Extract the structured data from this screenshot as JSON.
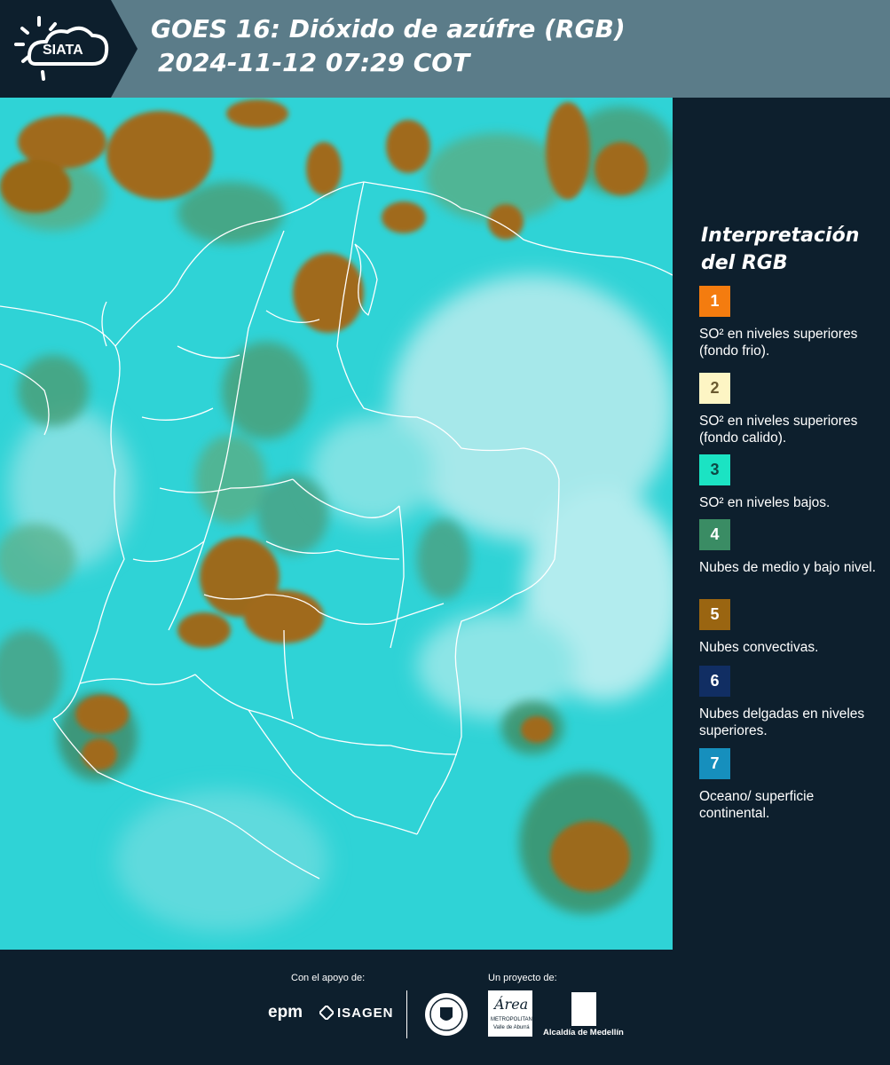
{
  "header": {
    "logo_text": "SIATA",
    "title_line1": "GOES 16: Dióxido de azúfre (RGB)",
    "title_line2": "2024-11-12 07:29 COT",
    "background": "#5b7c89",
    "logo_background": "#0d1f2d"
  },
  "map": {
    "background_color": "#2fd3d6",
    "border_color": "#ffffff"
  },
  "legend": {
    "title": "Interpretación del RGB",
    "items": [
      {
        "number": "1",
        "color": "#f47c0f",
        "number_color": "#ffffff",
        "label": "SO² en niveles superiores (fondo frio)."
      },
      {
        "number": "2",
        "color": "#fdf5c4",
        "number_color": "#6a5a30",
        "label": "SO² en niveles superiores (fondo calido)."
      },
      {
        "number": "3",
        "color": "#1be3c3",
        "number_color": "#0d4a45",
        "label": "SO² en niveles bajos."
      },
      {
        "number": "4",
        "color": "#3a8c64",
        "number_color": "#ffffff",
        "label": "Nubes de medio y bajo nivel."
      },
      {
        "number": "5",
        "color": "#9a6511",
        "number_color": "#ffffff",
        "label": "Nubes convectivas."
      },
      {
        "number": "6",
        "color": "#112e63",
        "number_color": "#ffffff",
        "label": "Nubes delgadas en niveles superiores."
      },
      {
        "number": "7",
        "color": "#168fbd",
        "number_color": "#ffffff",
        "label": "Oceano/ superficie continental."
      }
    ]
  },
  "footer": {
    "support_label": "Con el apoyo de:",
    "project_label": "Un proyecto de:",
    "sponsors": [
      "epm",
      "ISAGEN"
    ],
    "area_name": "Área",
    "area_sub1": "METROPOLITANA",
    "area_sub2": "Valle de Aburrá",
    "alcaldia": "Alcaldía de Medellín"
  }
}
